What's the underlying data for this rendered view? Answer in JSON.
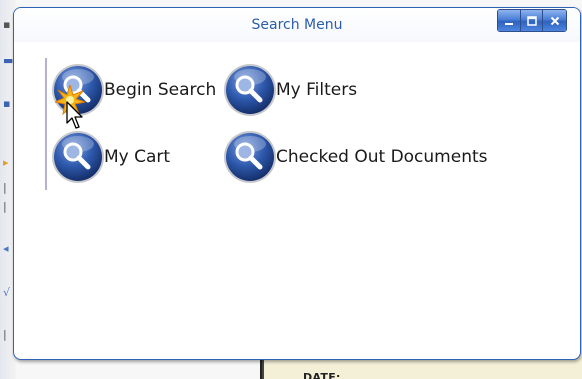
{
  "window": {
    "title": "Search Menu",
    "controls": [
      "minimize",
      "maximize",
      "close"
    ]
  },
  "menu": {
    "items": [
      {
        "label": "Begin Search",
        "icon": "magnifier-icon",
        "active": true
      },
      {
        "label": "My Filters",
        "icon": "magnifier-icon"
      },
      {
        "label": "My Cart",
        "icon": "magnifier-icon"
      },
      {
        "label": "Checked Out Documents",
        "icon": "magnifier-icon"
      }
    ]
  },
  "background": {
    "date_label": "DATE:"
  },
  "colors": {
    "title_text": "#2a5ea8",
    "window_border": "#2f63b8",
    "icon_blue": "#2d55a8",
    "accent_rule": "#b8aed0"
  }
}
